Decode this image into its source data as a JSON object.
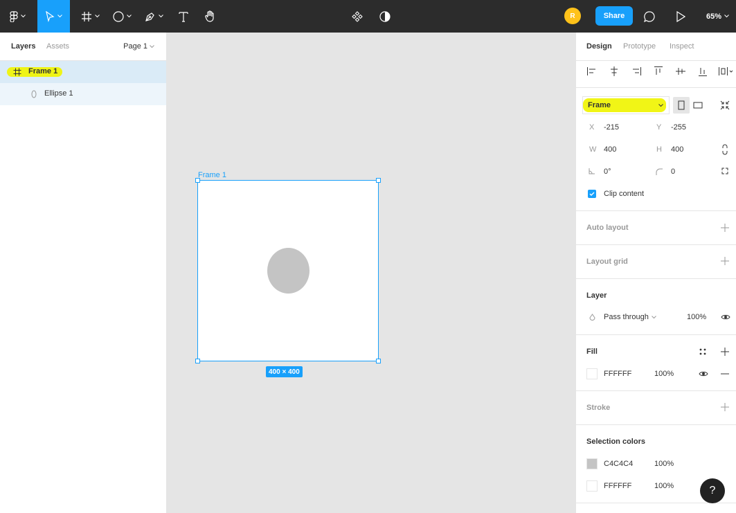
{
  "toolbar": {
    "avatar_initial": "R",
    "share_label": "Share",
    "zoom_label": "65%"
  },
  "left_panel": {
    "tabs": [
      {
        "label": "Layers"
      },
      {
        "label": "Assets"
      }
    ],
    "page_select": "Page 1",
    "layers": [
      {
        "name": "Frame 1",
        "icon": "frame-icon"
      },
      {
        "name": "Ellipse 1",
        "icon": "ellipse-icon"
      }
    ]
  },
  "canvas": {
    "frame_label": "Frame 1",
    "size_badge": "400 × 400",
    "frame_fill": "#FFFFFF",
    "ellipse_fill": "#C4C4C4",
    "selection_color": "#18A0FB"
  },
  "right_panel": {
    "tabs": [
      {
        "label": "Design"
      },
      {
        "label": "Prototype"
      },
      {
        "label": "Inspect"
      }
    ],
    "frame_preset": "Frame",
    "x_label": "X",
    "x_value": "-215",
    "y_label": "Y",
    "y_value": "-255",
    "w_label": "W",
    "w_value": "400",
    "h_label": "H",
    "h_value": "400",
    "rotation_value": "0°",
    "radius_value": "0",
    "clip_content_label": "Clip content",
    "clip_content_checked": true,
    "auto_layout_title": "Auto layout",
    "layout_grid_title": "Layout grid",
    "layer_title": "Layer",
    "blend_mode": "Pass through",
    "layer_opacity": "100%",
    "fill_title": "Fill",
    "fill": {
      "hex": "FFFFFF",
      "opacity": "100%"
    },
    "stroke_title": "Stroke",
    "selection_colors_title": "Selection colors",
    "selection_colors": [
      {
        "hex": "C4C4C4",
        "opacity": "100%"
      },
      {
        "hex": "FFFFFF",
        "opacity": "100%"
      }
    ]
  },
  "help_label": "?",
  "colors": {
    "accent": "#18A0FB",
    "toolbar_bg": "#2C2C2C",
    "highlight": "#F0F40A",
    "avatar": "#FFC21A"
  }
}
